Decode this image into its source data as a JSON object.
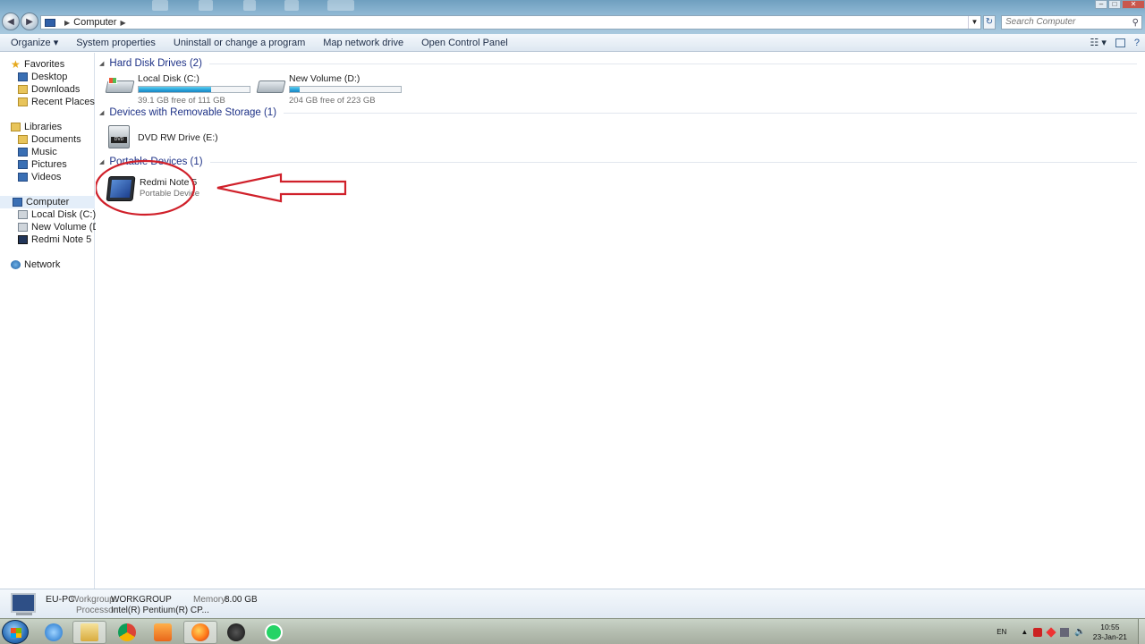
{
  "address": {
    "path": "Computer",
    "search_placeholder": "Search Computer"
  },
  "toolbar": {
    "organize": "Organize ▾",
    "system_properties": "System properties",
    "uninstall": "Uninstall or change a program",
    "map_drive": "Map network drive",
    "control_panel": "Open Control Panel"
  },
  "nav": {
    "favorites": "Favorites",
    "desktop": "Desktop",
    "downloads": "Downloads",
    "recent_places": "Recent Places",
    "libraries": "Libraries",
    "documents": "Documents",
    "music": "Music",
    "pictures": "Pictures",
    "videos": "Videos",
    "computer": "Computer",
    "local_disk": "Local Disk (C:)",
    "new_volume": "New Volume (D:)",
    "redmi": "Redmi Note 5",
    "network": "Network"
  },
  "groups": {
    "hdd": "Hard Disk Drives (2)",
    "removable": "Devices with Removable Storage (1)",
    "portable": "Portable Devices (1)"
  },
  "drives": [
    {
      "name": "Local Disk (C:)",
      "free": "39.1 GB free of 111 GB",
      "used_fraction": 0.65
    },
    {
      "name": "New Volume (D:)",
      "free": "204 GB free of 223 GB",
      "used_fraction": 0.085
    }
  ],
  "dvd": {
    "name": "DVD RW Drive (E:)",
    "label": "DVD"
  },
  "portable_device": {
    "name": "Redmi Note 5",
    "type": "Portable Device"
  },
  "details": {
    "pc_name": "EU-PC",
    "workgroup_label": "Workgroup:",
    "workgroup": "WORKGROUP",
    "memory_label": "Memory:",
    "memory": "8.00 GB",
    "processor_label": "Processor:",
    "processor": "Intel(R) Pentium(R) CP..."
  },
  "taskbar": {
    "lang": "EN",
    "time": "10:55",
    "date": "23-Jan-21"
  },
  "colors": {
    "accent": "#1e3287",
    "annotation": "#d0202a",
    "progress": "#26a0da"
  }
}
